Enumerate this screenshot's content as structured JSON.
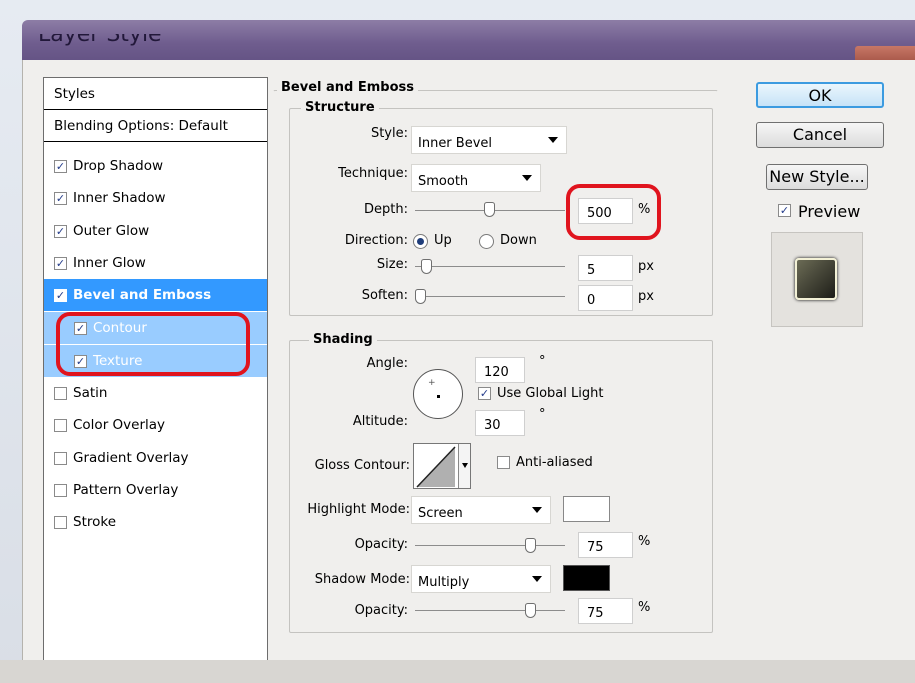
{
  "window": {
    "title": "Layer Style"
  },
  "styles_list": {
    "header": "Styles",
    "blending": "Blending Options: Default",
    "items": [
      {
        "label": "Drop Shadow",
        "checked": true
      },
      {
        "label": "Inner Shadow",
        "checked": true
      },
      {
        "label": "Outer Glow",
        "checked": true
      },
      {
        "label": "Inner Glow",
        "checked": true
      },
      {
        "label": "Bevel and Emboss",
        "checked": true
      },
      {
        "label": "Contour",
        "checked": true
      },
      {
        "label": "Texture",
        "checked": true
      },
      {
        "label": "Satin",
        "checked": false
      },
      {
        "label": "Color Overlay",
        "checked": false
      },
      {
        "label": "Gradient Overlay",
        "checked": false
      },
      {
        "label": "Pattern Overlay",
        "checked": false
      },
      {
        "label": "Stroke",
        "checked": false
      }
    ]
  },
  "bevel": {
    "section_title": "Bevel and Emboss",
    "structure_title": "Structure",
    "style_label": "Style:",
    "style_value": "Inner Bevel",
    "technique_label": "Technique:",
    "technique_value": "Smooth",
    "depth_label": "Depth:",
    "depth_value": "500",
    "depth_unit": "%",
    "direction_label": "Direction:",
    "direction_up": "Up",
    "direction_down": "Down",
    "size_label": "Size:",
    "size_value": "5",
    "size_unit": "px",
    "soften_label": "Soften:",
    "soften_value": "0",
    "soften_unit": "px"
  },
  "shading": {
    "title": "Shading",
    "angle_label": "Angle:",
    "angle_value": "120",
    "degree": "°",
    "use_global_light": "Use Global Light",
    "altitude_label": "Altitude:",
    "altitude_value": "30",
    "gloss_label": "Gloss Contour:",
    "anti_aliased": "Anti-aliased",
    "highlight_label": "Highlight Mode:",
    "highlight_value": "Screen",
    "highlight_color": "#ffffff",
    "opacity_label": "Opacity:",
    "highlight_opacity": "75",
    "shadow_label": "Shadow Mode:",
    "shadow_value": "Multiply",
    "shadow_color": "#000000",
    "shadow_opacity": "75",
    "pct": "%"
  },
  "buttons": {
    "ok": "OK",
    "cancel": "Cancel",
    "new_style": "New Style...",
    "preview": "Preview"
  },
  "accent": {
    "selected": "#3399ff",
    "sub_selected": "#99ccff",
    "highlight_ring": "#e0141e"
  }
}
